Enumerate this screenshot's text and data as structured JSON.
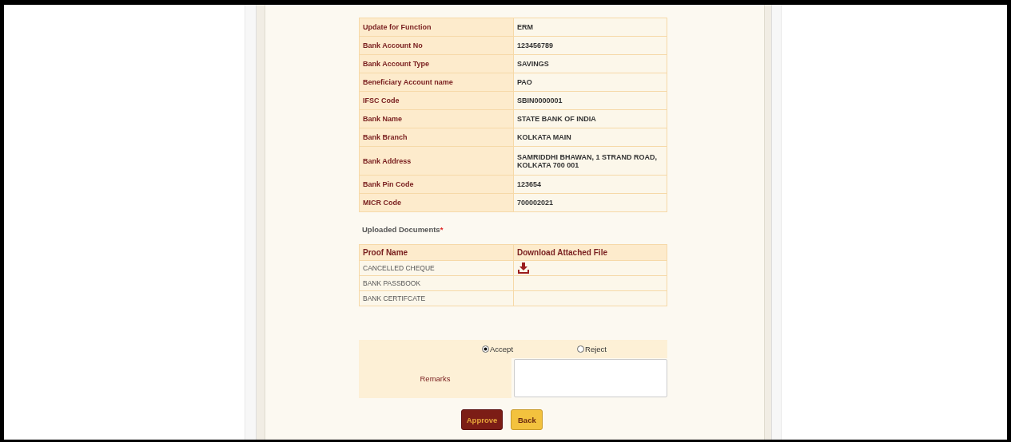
{
  "details": [
    {
      "label": "Update for Function",
      "value": "ERM"
    },
    {
      "label": "Bank Account No",
      "value": "123456789"
    },
    {
      "label": "Bank Account Type",
      "value": "SAVINGS"
    },
    {
      "label": "Beneficiary Account name",
      "value": "PAO"
    },
    {
      "label": "IFSC Code",
      "value": "SBIN0000001"
    },
    {
      "label": "Bank Name",
      "value": "STATE BANK OF INDIA"
    },
    {
      "label": "Bank Branch",
      "value": "KOLKATA MAIN"
    },
    {
      "label": "Bank Address",
      "value": "SAMRIDDHI BHAWAN, 1 STRAND ROAD, KOLKATA 700 001"
    },
    {
      "label": "Bank Pin Code",
      "value": "123654"
    },
    {
      "label": "MICR Code",
      "value": "700002021"
    }
  ],
  "documents_heading": "Uploaded Documents",
  "required_mark": "*",
  "documents": {
    "columns": [
      "Proof Name",
      "Download Attached File"
    ],
    "rows": [
      {
        "name": "CANCELLED CHEQUE",
        "has_file": true
      },
      {
        "name": "BANK PASSBOOK",
        "has_file": false
      },
      {
        "name": "BANK CERTIFCATE",
        "has_file": false
      }
    ]
  },
  "decision": [
    {
      "label": "Accept",
      "selected": true
    },
    {
      "label": "Reject",
      "selected": false
    }
  ],
  "remarks": {
    "label": "Remarks"
  },
  "buttons": [
    {
      "label": "Approve",
      "kind": "primary"
    },
    {
      "label": "Back",
      "kind": "secondary"
    }
  ]
}
